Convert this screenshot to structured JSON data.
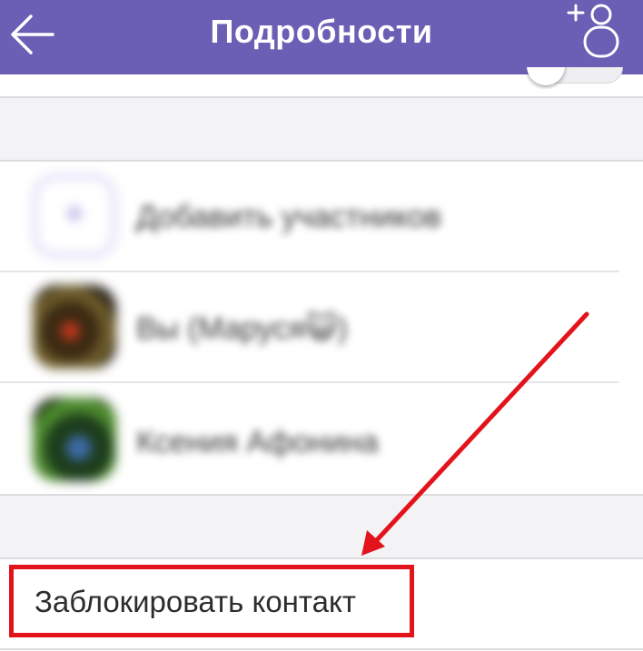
{
  "header": {
    "title": "Подробности",
    "back_icon": "arrow-left-icon",
    "add_contact_icon": "add-contact-icon",
    "background": "#6a5fb4"
  },
  "participants": [
    {
      "label": "Добавить участников",
      "avatar": "add-participant-icon"
    },
    {
      "label": "Вы (Маруся😺)",
      "avatar": "photo"
    },
    {
      "label": "Ксения Афонина",
      "avatar": "photo"
    }
  ],
  "actions": {
    "block_contact": "Заблокировать контакт"
  },
  "annotation": {
    "color": "#e3131b"
  }
}
